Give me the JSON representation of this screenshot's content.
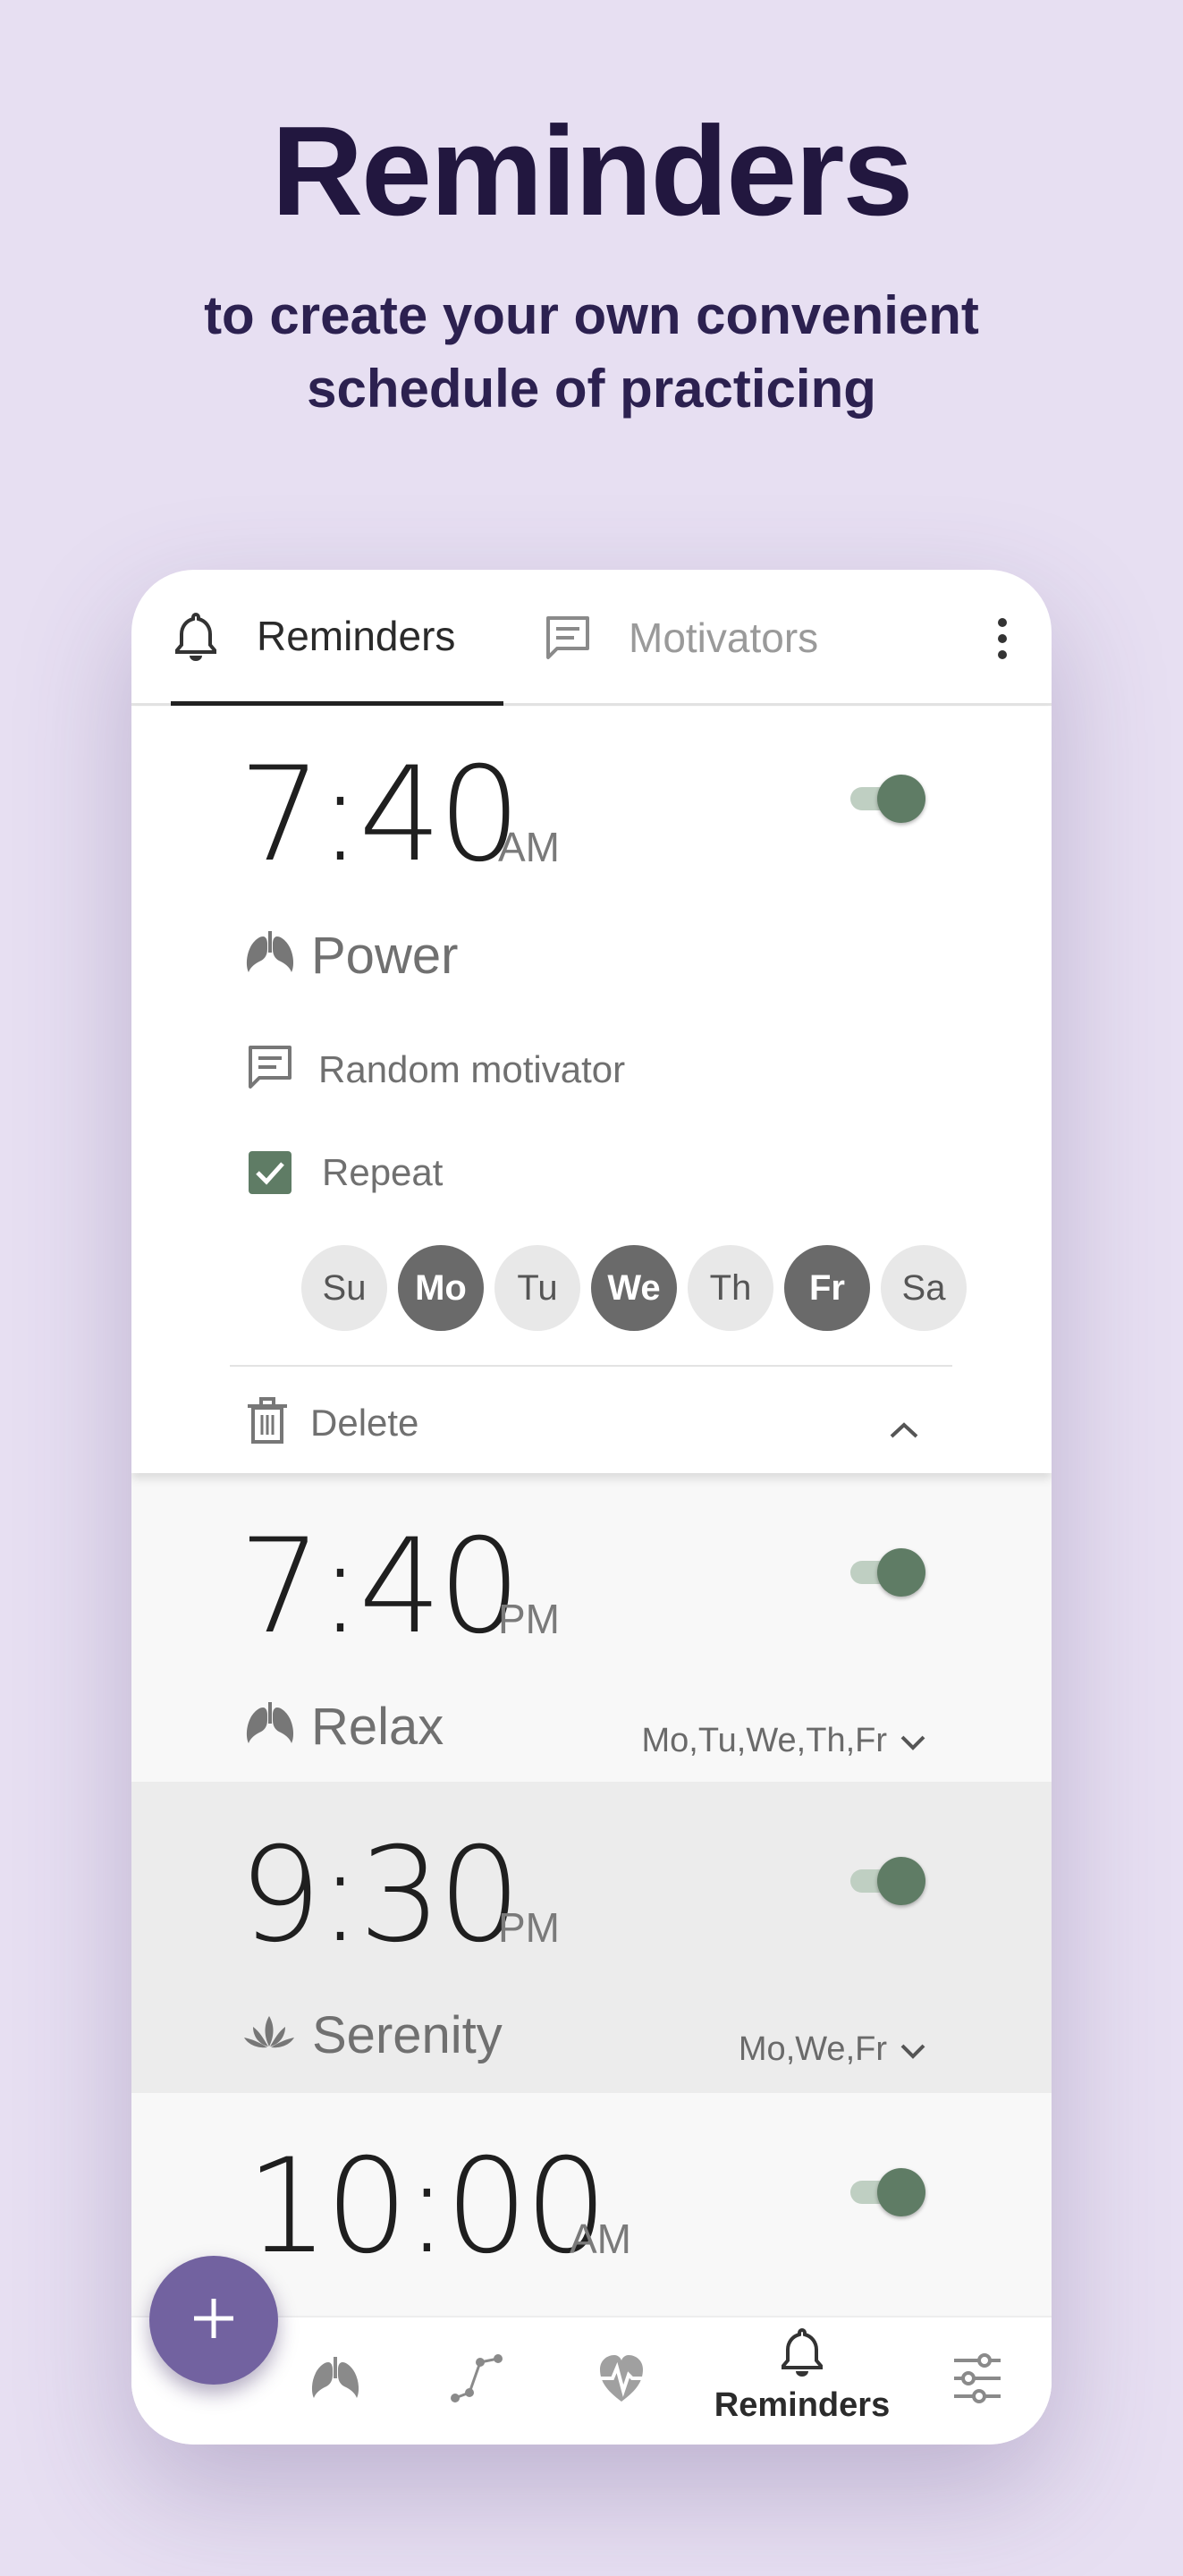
{
  "promo": {
    "title": "Reminders",
    "subtitle_line1": "to create your own convenient",
    "subtitle_line2": "schedule of practicing"
  },
  "tabs": [
    {
      "label": "Reminders",
      "icon": "bell-icon",
      "active": true
    },
    {
      "label": "Motivators",
      "icon": "message-icon",
      "active": false
    }
  ],
  "reminders": [
    {
      "time": "7:40",
      "ampm": "AM",
      "enabled": true,
      "expanded": true,
      "exercise": "Power",
      "exercise_icon": "lungs-icon",
      "motivator": "Random motivator",
      "repeat_label": "Repeat",
      "repeat": true,
      "days": [
        {
          "label": "Su",
          "on": false
        },
        {
          "label": "Mo",
          "on": true
        },
        {
          "label": "Tu",
          "on": false
        },
        {
          "label": "We",
          "on": true
        },
        {
          "label": "Th",
          "on": false
        },
        {
          "label": "Fr",
          "on": true
        },
        {
          "label": "Sa",
          "on": false
        }
      ],
      "delete_label": "Delete"
    },
    {
      "time": "7:40",
      "ampm": "PM",
      "enabled": true,
      "exercise": "Relax",
      "exercise_icon": "lungs-icon",
      "days_summary": "Mo,Tu,We,Th,Fr"
    },
    {
      "time": "9:30",
      "ampm": "PM",
      "enabled": true,
      "exercise": "Serenity",
      "exercise_icon": "lotus-icon",
      "days_summary": "Mo,We,Fr"
    },
    {
      "time": "10:00",
      "ampm": "AM",
      "enabled": true
    }
  ],
  "bottom_nav": {
    "active_label": "Reminders",
    "items": [
      "lungs-icon",
      "progress-chart-icon",
      "heart-rate-icon",
      "bell-icon",
      "sliders-icon"
    ]
  },
  "colors": {
    "background": "#e7dff2",
    "title": "#22173f",
    "accent_green": "#5f7c65",
    "fab": "#7262a0"
  }
}
